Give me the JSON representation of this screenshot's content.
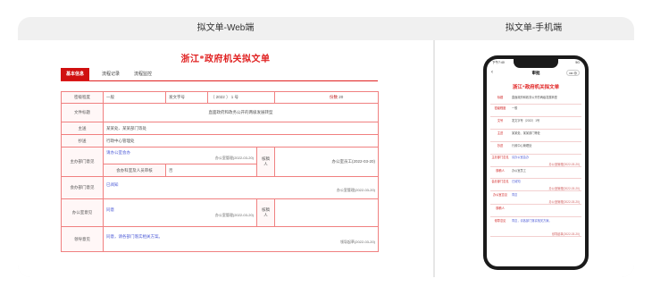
{
  "headers": {
    "web": "拟文单-Web端",
    "mobile": "拟文单-手机端"
  },
  "web": {
    "title": "浙江*政府机关拟文单",
    "tabs": [
      "基本信息",
      "流程记录",
      "流程监控"
    ],
    "rows": {
      "secret_label": "密级程度",
      "secret_value": "一般",
      "doc_no_label": "发文字号",
      "doc_no_value": "〔 2022 〕 1 号",
      "pages_label": "份数",
      "pages_value": "20",
      "title_label": "文件标题",
      "title_value": "直面政府和政务公开的两级发展转型",
      "main_send_label": "主送",
      "main_send_value": "某某处、某某部门等处",
      "cc_label": "抄送",
      "cc_value": "行政中心管理处",
      "host_label": "主办部门意见",
      "host_opinion": "请办公室会办",
      "host_sign": "办公室管理(2022-03-20)",
      "dept_btn": "会办科室及人员审核",
      "dept_value": "否",
      "checker_label": "核稿人",
      "checker_sign": "办公室员工(2022-03-20)",
      "co_label": "会办部门意见",
      "co_opinion": "已阅知",
      "co_sign": "办公室管理(2022-03-20)",
      "office_label": "办公室意见",
      "office_opinion": "同意",
      "office_sign": "办公室管理(2022-03-20)",
      "reviewer_label": "核稿人",
      "leader_label": "领导意见",
      "leader_opinion": "同意，请各部门落实相关方案。",
      "leader_sign": "领导起草(2022-03-20)"
    }
  },
  "mobile": {
    "status_time": "下午7:40",
    "status_right": "5G",
    "nav_title": "审批",
    "back_icon": "back-chevron-icon",
    "title": "浙江*政府机关拟文单",
    "rows": [
      {
        "label": "标题",
        "value": "直面政府和政务公开的两级发展转型",
        "style": "plain"
      },
      {
        "label": "密级程度",
        "value": "一般",
        "style": "plain"
      },
      {
        "label": "文号",
        "value": "发文字号〔2022〕1号",
        "style": "plain"
      },
      {
        "label": "主送",
        "value": "某某处、某某部门等处",
        "style": "plain"
      },
      {
        "label": "抄送",
        "value": "行政中心管理处",
        "style": "plain"
      },
      {
        "label": "主办部门意见",
        "value": "请办公室会办",
        "sign": "办公室管理(2022-03-20)",
        "style": "blue"
      },
      {
        "label": "核稿人",
        "value": "办公室员工",
        "style": "plain"
      },
      {
        "label": "会办部门意见",
        "value": "已阅知",
        "sign": "办公室管理(2022-03-20)",
        "style": "blue"
      },
      {
        "label": "办公室意见",
        "value": "同意",
        "sign": "办公室管理(2022-03-20)",
        "style": "blue"
      },
      {
        "label": "核稿人",
        "value": "",
        "style": "plain"
      },
      {
        "label": "领导意见",
        "value": "同意，请各部门落实相关方案。",
        "sign": "领导起草(2022-03-20)",
        "style": "blue"
      }
    ]
  }
}
